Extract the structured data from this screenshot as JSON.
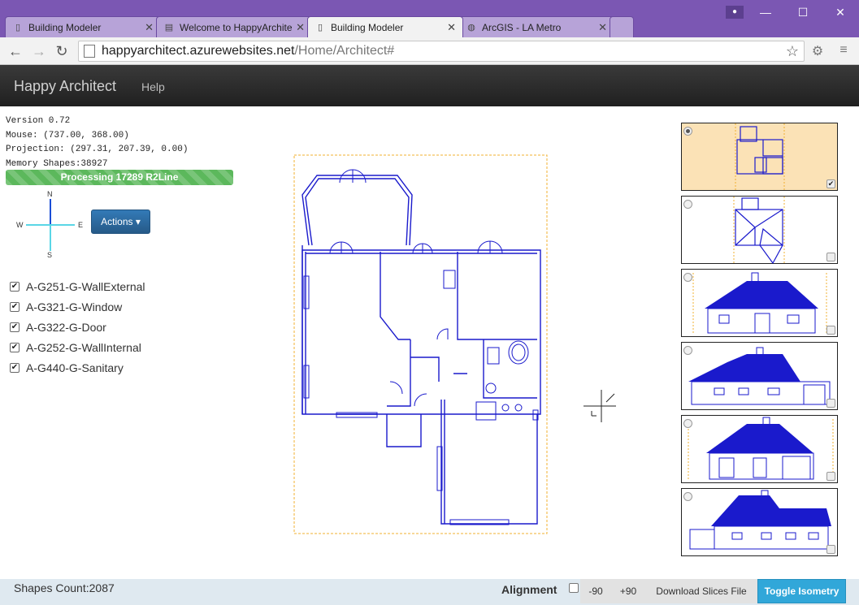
{
  "browser": {
    "tabs": [
      {
        "title": "Building Modeler",
        "icon": "page-icon",
        "active": false
      },
      {
        "title": "Welcome to HappyArchite",
        "icon": "book-icon",
        "active": false
      },
      {
        "title": "Building Modeler",
        "icon": "page-icon",
        "active": true
      },
      {
        "title": "ArcGIS - LA Metro",
        "icon": "globe-icon",
        "active": false
      }
    ],
    "url_host": "happyarchitect.azurewebsites.net",
    "url_path": "/Home/Architect#"
  },
  "navbar": {
    "brand": "Happy Architect",
    "help": "Help"
  },
  "info": {
    "version": "Version 0.72",
    "mouse": "Mouse: (737.00, 368.00)",
    "projection": "Projection: (297.31, 207.39, 0.00)",
    "memory": "Memory Shapes:38927"
  },
  "progress": {
    "label": "Processing 17289 R2Line",
    "fraction": 1.0,
    "color": "#5cb85c"
  },
  "compass": {
    "n": "N",
    "s": "S",
    "e": "E",
    "w": "W",
    "ns_color": "#1a4dd6",
    "ew_color": "#5ad6e6"
  },
  "actions_label": "Actions ▾",
  "layers": [
    {
      "label": "A-G251-G-WallExternal",
      "checked": true
    },
    {
      "label": "A-G321-G-Window",
      "checked": true
    },
    {
      "label": "A-G322-G-Door",
      "checked": true
    },
    {
      "label": "A-G252-G-WallInternal",
      "checked": true
    },
    {
      "label": "A-G440-G-Sanitary",
      "checked": true
    }
  ],
  "thumbnails": [
    {
      "view": "plan",
      "selected": true,
      "checked": true
    },
    {
      "view": "roof",
      "selected": false,
      "checked": false
    },
    {
      "view": "elevation-front",
      "selected": false,
      "checked": false
    },
    {
      "view": "elevation-side",
      "selected": false,
      "checked": false
    },
    {
      "view": "elevation-rear",
      "selected": false,
      "checked": false
    },
    {
      "view": "elevation-other",
      "selected": false,
      "checked": false
    }
  ],
  "status": {
    "shapes_count": "Shapes Count:2087",
    "alignment": "Alignment",
    "minus90": "-90",
    "plus90": "+90",
    "download": "Download Slices File",
    "toggle": "Toggle Isometry"
  },
  "colors": {
    "drawing": "#1a1acc",
    "bounds": "#f0b030",
    "accent": "#31a7d9"
  }
}
